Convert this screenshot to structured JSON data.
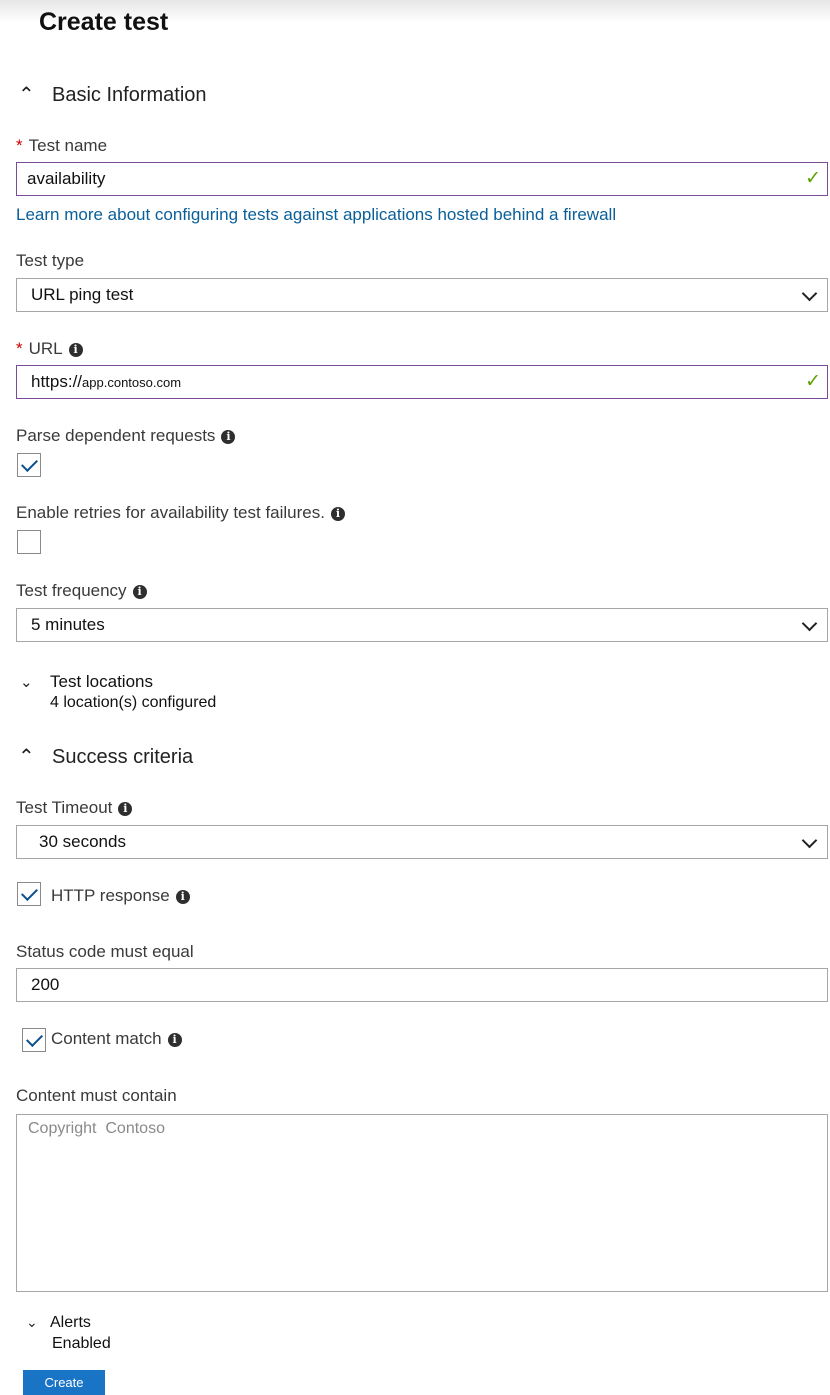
{
  "page": {
    "title": "Create test",
    "create_label": "Create"
  },
  "basic": {
    "heading": "Basic Information",
    "test_name": {
      "label": "Test name",
      "value": "availability"
    },
    "firewall_link": "Learn more about configuring tests against applications hosted behind a firewall",
    "test_type": {
      "label": "Test type",
      "value": "URL ping test"
    },
    "url": {
      "label": "URL",
      "scheme": "https://",
      "host": "app.contoso.com"
    },
    "parse_dependent": {
      "label": "Parse dependent requests",
      "checked": true
    },
    "enable_retries": {
      "label": "Enable retries for availability test failures.",
      "checked": false
    },
    "frequency": {
      "label": "Test frequency",
      "value": "5 minutes"
    }
  },
  "locations": {
    "heading": "Test locations",
    "summary": "4 location(s) configured"
  },
  "success": {
    "heading": "Success criteria",
    "timeout": {
      "label": "Test Timeout",
      "value": "30 seconds"
    },
    "http_response": {
      "label": "HTTP response",
      "checked": true
    },
    "status_code": {
      "label": "Status code must equal",
      "value": "200"
    },
    "content_match": {
      "label": "Content match",
      "checked": true
    },
    "content_contain": {
      "label": "Content must contain",
      "value": "Copyright  Contoso"
    }
  },
  "alerts": {
    "heading": "Alerts",
    "summary": "Enabled"
  },
  "colors": {
    "link": "#0a5f99",
    "required": "#cc0000",
    "valid_check": "#57a300",
    "valid_border": "#7b4c96",
    "button": "#1a74c6"
  }
}
